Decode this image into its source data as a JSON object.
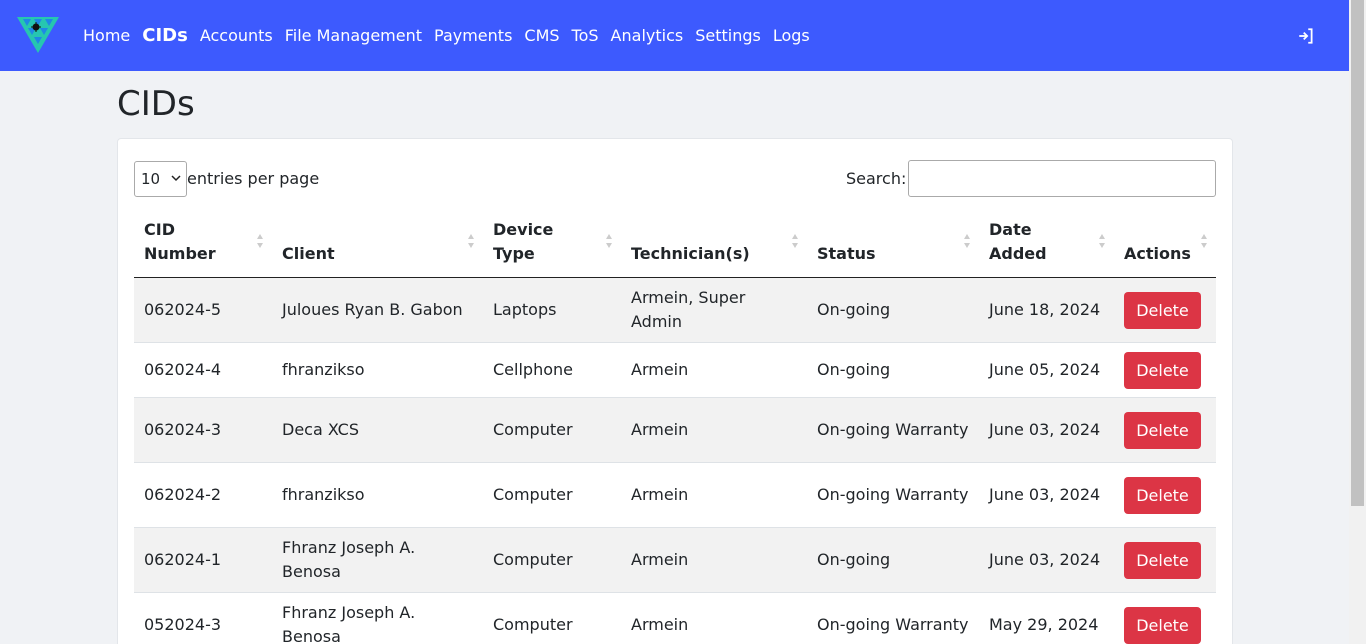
{
  "nav": {
    "links": [
      {
        "label": "Home",
        "active": false
      },
      {
        "label": "CIDs",
        "active": true
      },
      {
        "label": "Accounts",
        "active": false
      },
      {
        "label": "File Management",
        "active": false
      },
      {
        "label": "Payments",
        "active": false
      },
      {
        "label": "CMS",
        "active": false
      },
      {
        "label": "ToS",
        "active": false
      },
      {
        "label": "Analytics",
        "active": false
      },
      {
        "label": "Settings",
        "active": false
      },
      {
        "label": "Logs",
        "active": false
      }
    ],
    "bg_color": "#3d5afe"
  },
  "page": {
    "title": "CIDs"
  },
  "controls": {
    "entries_value": "10",
    "entries_label": "entries per page",
    "search_label": "Search:",
    "search_value": ""
  },
  "table": {
    "headers": [
      {
        "line1": "CID",
        "line2": "Number"
      },
      {
        "line1": "",
        "line2": "Client"
      },
      {
        "line1": "Device",
        "line2": "Type"
      },
      {
        "line1": "",
        "line2": "Technician(s)"
      },
      {
        "line1": "",
        "line2": "Status"
      },
      {
        "line1": "Date",
        "line2": "Added"
      },
      {
        "line1": "",
        "line2": "Actions"
      }
    ],
    "rows": [
      {
        "cid": "062024-5",
        "client": "Juloues Ryan B. Gabon",
        "device": "Laptops",
        "tech": "Armein, Super Admin",
        "status": "On-going",
        "date": "June 18, 2024",
        "action": "Delete"
      },
      {
        "cid": "062024-4",
        "client": "fhranzikso",
        "device": "Cellphone",
        "tech": "Armein",
        "status": "On-going",
        "date": "June 05, 2024",
        "action": "Delete"
      },
      {
        "cid": "062024-3",
        "client": "Deca XCS",
        "device": "Computer",
        "tech": "Armein",
        "status": "On-going Warranty",
        "date": "June 03, 2024",
        "action": "Delete"
      },
      {
        "cid": "062024-2",
        "client": "fhranzikso",
        "device": "Computer",
        "tech": "Armein",
        "status": "On-going Warranty",
        "date": "June 03, 2024",
        "action": "Delete"
      },
      {
        "cid": "062024-1",
        "client": "Fhranz Joseph A. Benosa",
        "device": "Computer",
        "tech": "Armein",
        "status": "On-going",
        "date": "June 03, 2024",
        "action": "Delete"
      },
      {
        "cid": "052024-3",
        "client": "Fhranz Joseph A. Benosa",
        "device": "Computer",
        "tech": "Armein",
        "status": "On-going Warranty",
        "date": "May 29, 2024",
        "action": "Delete"
      }
    ]
  },
  "colors": {
    "danger": "#dc3545",
    "content_bg": "#f0f2f5"
  }
}
